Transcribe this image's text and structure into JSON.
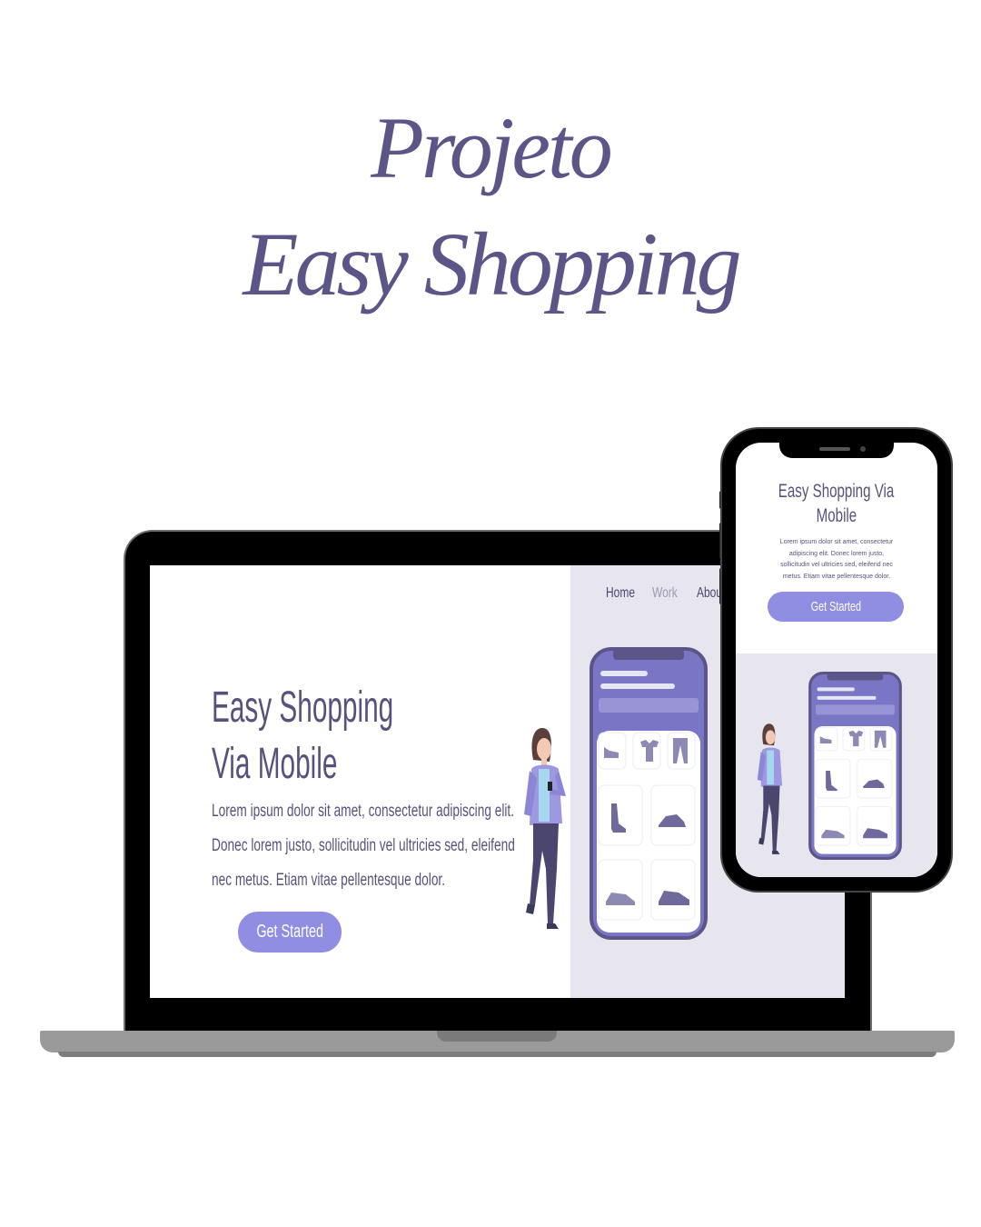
{
  "headline": {
    "line1": "Projeto",
    "line2": "Easy Shopping"
  },
  "desktop": {
    "nav": [
      "Home",
      "Work",
      "About"
    ],
    "title_line1": "Easy Shopping",
    "title_line2": "Via Mobile",
    "body_lines": [
      "Lorem ipsum dolor sit amet, consectetur adipiscing elit.",
      "Donec lorem justo, sollicitudin vel ultricies sed, eleifend",
      "nec metus. Etiam vitae pellentesque dolor."
    ],
    "cta": "Get Started"
  },
  "mobile": {
    "title_line1": "Easy Shopping Via",
    "title_line2": "Mobile",
    "body_lines": [
      "Lorem ipsum dolor sit amet, consectetur",
      "adipiscing elit. Donec lorem justo,",
      "sollicitudin vel ultricies sed, eleifend nec",
      "metus. Etiam vitae pellentesque dolor."
    ],
    "cta": "Get Started"
  },
  "colors": {
    "brand": "#5b5687",
    "accent": "#8f8ee3",
    "panel": "#e7e6ee"
  }
}
